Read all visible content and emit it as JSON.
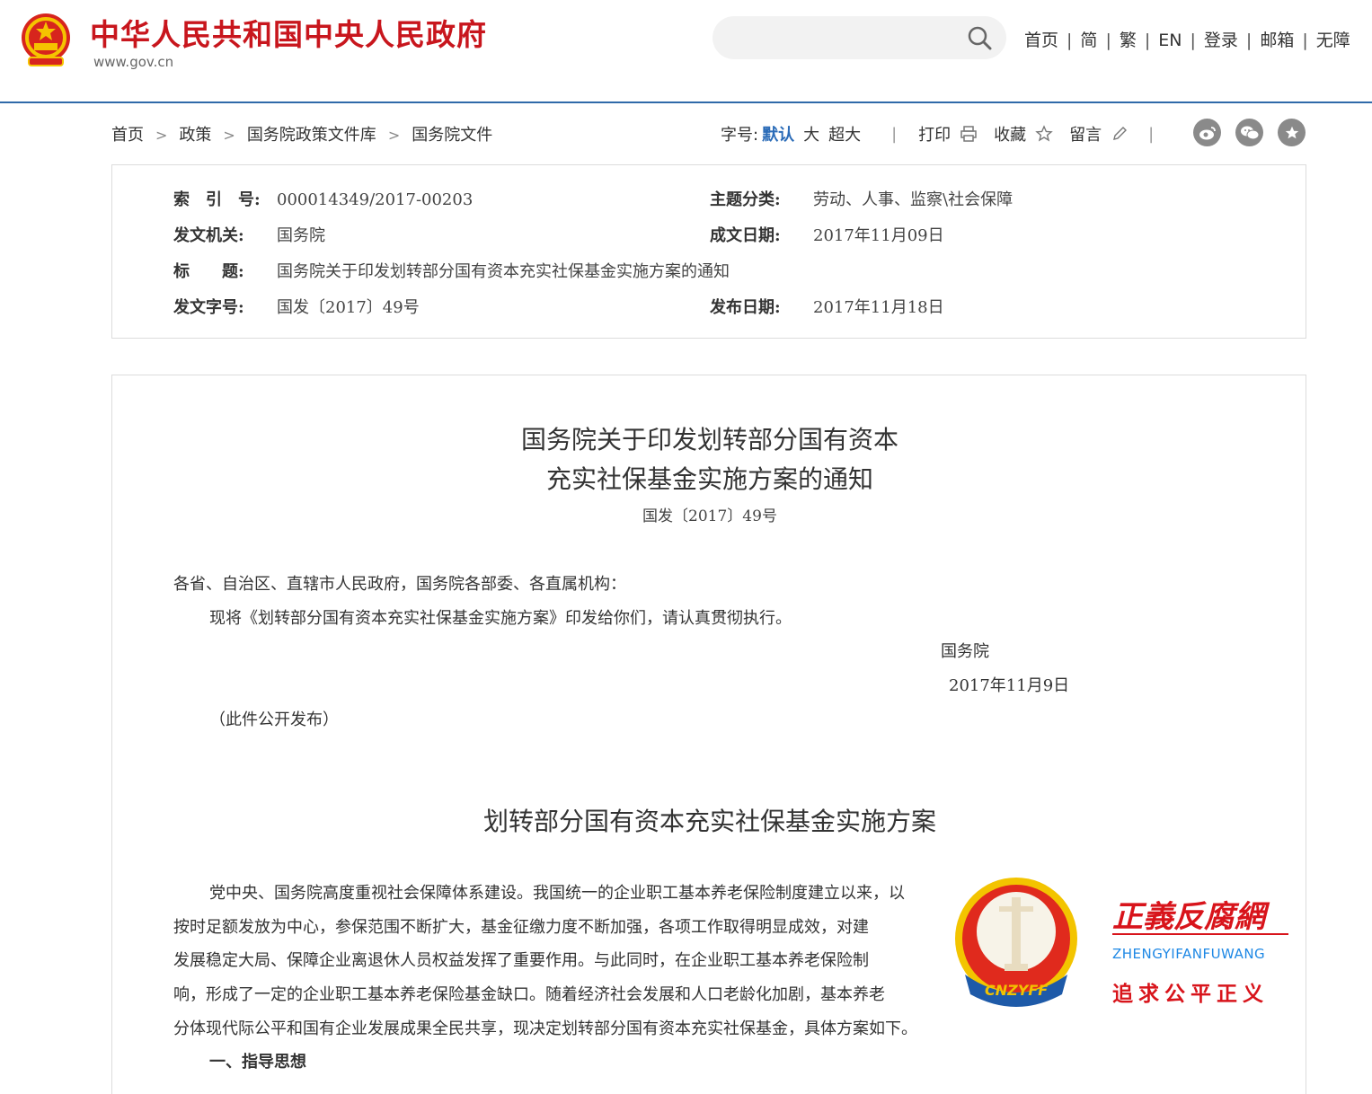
{
  "header": {
    "site_title": "中华人民共和国中央人民政府",
    "site_url": "www.gov.cn",
    "search": {
      "placeholder": "",
      "value": ""
    },
    "nav": [
      "首页",
      "简",
      "繁",
      "EN",
      "登录",
      "邮箱",
      "无障"
    ]
  },
  "breadcrumb": [
    "首页",
    "政策",
    "国务院政策文件库",
    "国务院文件"
  ],
  "tools": {
    "font_label": "字号:",
    "font_default": "默认",
    "font_large": "大",
    "font_xlarge": "超大",
    "print": "打印",
    "favorite": "收藏",
    "comment": "留言"
  },
  "meta": {
    "index_label": "索　引　号:",
    "index_value": "000014349/2017-00203",
    "topic_label": "主题分类:",
    "topic_value": "劳动、人事、监察\\社会保障",
    "issuer_label": "发文机关:",
    "issuer_value": "国务院",
    "written_label": "成文日期:",
    "written_value": "2017年11月09日",
    "title_label": "标　　题:",
    "title_value": "国务院关于印发划转部分国有资本充实社保基金实施方案的通知",
    "docno_label": "发文字号:",
    "docno_value": "国发〔2017〕49号",
    "published_label": "发布日期:",
    "published_value": "2017年11月18日"
  },
  "document": {
    "title_line1": "国务院关于印发划转部分国有资本",
    "title_line2": "充实社保基金实施方案的通知",
    "number": "国发〔2017〕49号",
    "salutation": "各省、自治区、直辖市人民政府，国务院各部委、各直属机构：",
    "body": "现将《划转部分国有资本充实社保基金实施方案》印发给你们，请认真贯彻执行。",
    "signature": "国务院",
    "date": "2017年11月9日",
    "public_note": "（此件公开发布）",
    "plan_title": "划转部分国有资本充实社保基金实施方案",
    "plan_lines": [
      "党中央、国务院高度重视社会保障体系建设。我国统一的企业职工基本养老保险制度建立以来，以",
      "按时足额发放为中心，参保范围不断扩大，基金征缴力度不断加强，各项工作取得明显成效，对建",
      "发展稳定大局、保障企业离退休人员权益发挥了重要作用。与此同时，在企业职工基本养老保险制",
      "响，形成了一定的企业职工基本养老保险基金缺口。随着经济社会发展和人口老龄化加剧，基本养老",
      "分体现代际公平和国有企业发展成果全民共享，现决定划转部分国有资本充实社保基金，具体方案如下。"
    ],
    "section_1": "一、指导思想"
  },
  "watermark": {
    "title": "正義反腐網",
    "pinyin": "ZHENGYIFANFUWANG",
    "slogan": "追求公平正义",
    "badge_text": "CNZYFF"
  },
  "colors": {
    "brand_red": "#c8161d",
    "link_blue": "#2b6cb8",
    "divider_blue": "#2f6aa9"
  }
}
